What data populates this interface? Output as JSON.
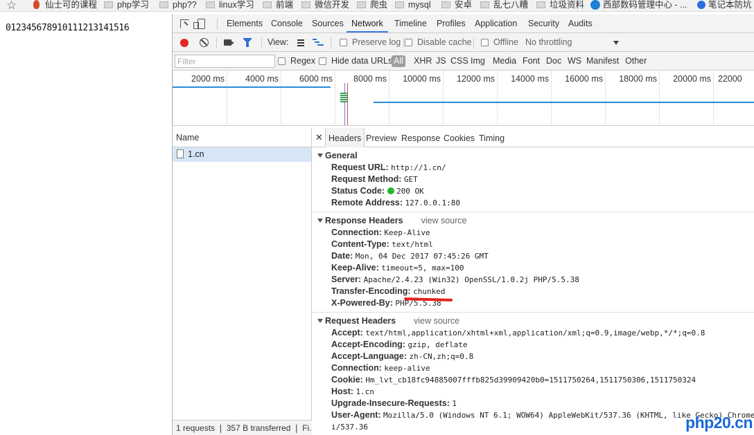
{
  "bookmarks": {
    "items": [
      "仙士可的课程",
      "php学习",
      "php??",
      "linux学习",
      "前端",
      "微信开发",
      "爬虫",
      "mysql",
      "安卓",
      "乱七八糟",
      "垃圾资料",
      "西部数码管理中心 - ...",
      "笔记本防坑"
    ]
  },
  "page": {
    "text": "012345678910111213141516"
  },
  "devtools": {
    "tabs": [
      "Elements",
      "Console",
      "Sources",
      "Network",
      "Timeline",
      "Profiles",
      "Application",
      "Security",
      "Audits"
    ],
    "active_tab": "Network",
    "toolbar": {
      "view_label": "View:",
      "preserve_log": "Preserve log",
      "disable_cache": "Disable cache",
      "offline": "Offline",
      "throttling": "No throttling"
    },
    "filter": {
      "placeholder": "Filter",
      "regex": "Regex",
      "hide_data_urls": "Hide data URLs",
      "types": [
        "All",
        "XHR",
        "JS",
        "CSS",
        "Img",
        "Media",
        "Font",
        "Doc",
        "WS",
        "Manifest",
        "Other"
      ]
    },
    "timeline_ticks": [
      "2000 ms",
      "4000 ms",
      "6000 ms",
      "8000 ms",
      "10000 ms",
      "12000 ms",
      "14000 ms",
      "16000 ms",
      "18000 ms",
      "20000 ms",
      "22000"
    ],
    "name_header": "Name",
    "request": "1.cn",
    "status_summary": "1 requests ❘ 357 B transferred ❘ Fi...",
    "detail_tabs": [
      "Headers",
      "Preview",
      "Response",
      "Cookies",
      "Timing"
    ],
    "general": {
      "title": "General",
      "rows": [
        {
          "k": "Request URL:",
          "v": "http://1.cn/"
        },
        {
          "k": "Request Method:",
          "v": "GET"
        },
        {
          "k": "Status Code:",
          "v": "200 OK"
        },
        {
          "k": "Remote Address:",
          "v": "127.0.0.1:80"
        }
      ]
    },
    "response_headers": {
      "title": "Response Headers",
      "view_source": "view source",
      "rows": [
        {
          "k": "Connection:",
          "v": "Keep-Alive"
        },
        {
          "k": "Content-Type:",
          "v": "text/html"
        },
        {
          "k": "Date:",
          "v": "Mon, 04 Dec 2017 07:45:26 GMT"
        },
        {
          "k": "Keep-Alive:",
          "v": "timeout=5, max=100"
        },
        {
          "k": "Server:",
          "v": "Apache/2.4.23 (Win32) OpenSSL/1.0.2j PHP/5.5.38"
        },
        {
          "k": "Transfer-Encoding:",
          "v": "chunked"
        },
        {
          "k": "X-Powered-By:",
          "v": "PHP/5.5.38"
        }
      ]
    },
    "request_headers": {
      "title": "Request Headers",
      "view_source": "view source",
      "rows": [
        {
          "k": "Accept:",
          "v": "text/html,application/xhtml+xml,application/xml;q=0.9,image/webp,*/*;q=0.8"
        },
        {
          "k": "Accept-Encoding:",
          "v": "gzip, deflate"
        },
        {
          "k": "Accept-Language:",
          "v": "zh-CN,zh;q=0.8"
        },
        {
          "k": "Connection:",
          "v": "keep-alive"
        },
        {
          "k": "Cookie:",
          "v": "Hm_lvt_cb18fc94885007fffb825d39909420b0=1511750264,1511750306,1511750324"
        },
        {
          "k": "Host:",
          "v": "1.cn"
        },
        {
          "k": "Upgrade-Insecure-Requests:",
          "v": "1"
        },
        {
          "k": "User-Agent:",
          "v": "Mozilla/5.0 (Windows NT 6.1; WOW64) AppleWebKit/537.36 (KHTML, like Gecko) Chrome/"
        },
        {
          "k": "",
          "v": "i/537.36"
        }
      ]
    }
  },
  "watermark": "php20.cn",
  "colors": {
    "accent": "#3b7be0",
    "record": "#e32424",
    "status_ok": "#28b428",
    "annotation": "#e8241c",
    "selected_row": "#d7e6f7"
  }
}
